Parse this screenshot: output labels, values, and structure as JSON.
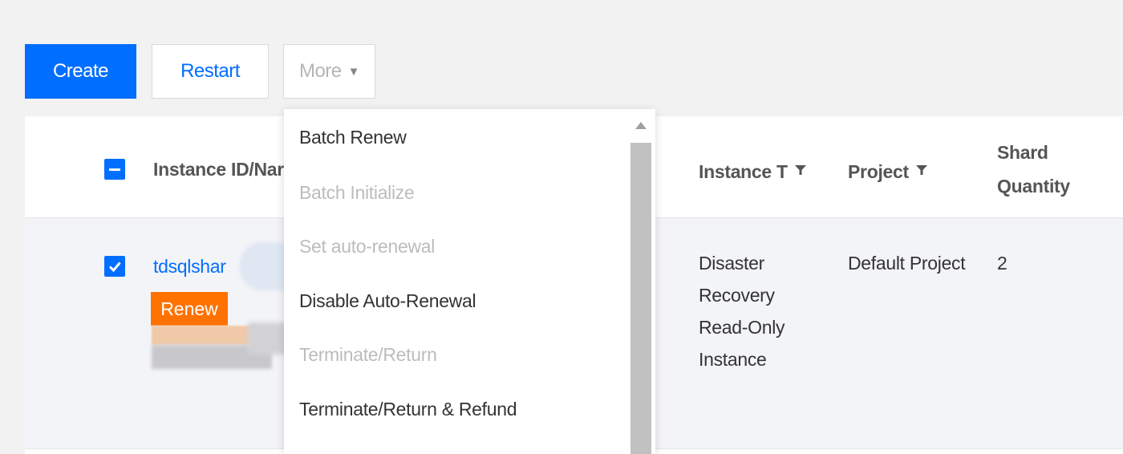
{
  "toolbar": {
    "create_label": "Create",
    "restart_label": "Restart",
    "more_label": "More",
    "more_caret": "▼"
  },
  "table": {
    "headers": {
      "instance_id_name": "Instance ID/Nar",
      "instance_type": "Instance T",
      "project": "Project",
      "shard_quantity_line1": "Shard",
      "shard_quantity_line2": "Quantity"
    },
    "row": {
      "instance_id": "tdsqlshar",
      "renew_tag": "Renew",
      "instance_type_lines": [
        "Disaster",
        "Recovery",
        "Read-Only",
        "Instance"
      ],
      "project": "Default Project",
      "shard_quantity": "2"
    }
  },
  "dropdown": {
    "items": [
      {
        "label": "Batch Renew",
        "disabled": false
      },
      {
        "label": "Batch Initialize",
        "disabled": true
      },
      {
        "label": "Set auto-renewal",
        "disabled": true
      },
      {
        "label": "Disable Auto-Renewal",
        "disabled": false
      },
      {
        "label": "Terminate/Return",
        "disabled": true
      },
      {
        "label": "Terminate/Return & Refund",
        "disabled": false
      }
    ]
  },
  "colors": {
    "primary": "#006eff",
    "renew_tag": "#ff7200",
    "disabled_text": "#bcbcbc"
  },
  "icons": {
    "filter": "filter-icon",
    "checkbox_checked": "check-icon",
    "checkbox_indeterminate": "minus-icon"
  }
}
